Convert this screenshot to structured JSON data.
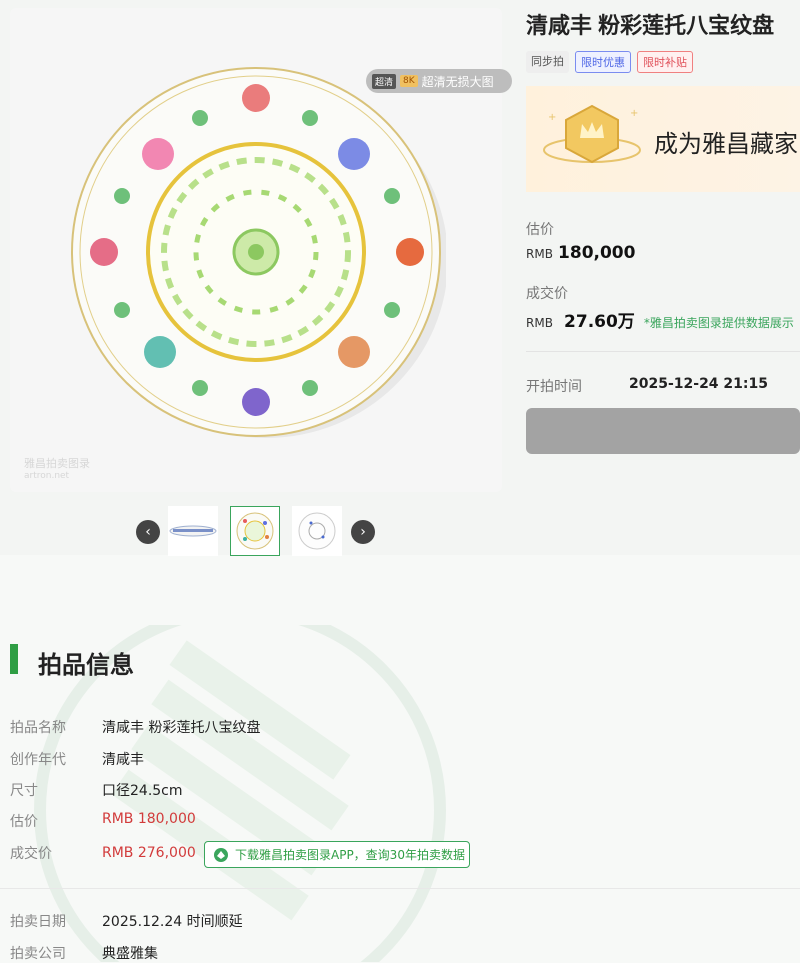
{
  "gallery": {
    "badge_tag1": "超清",
    "badge_tag2": "8K",
    "badge_text": "超清无损大图",
    "watermark_line1": "雅昌拍卖图录",
    "watermark_line2": "artron.net"
  },
  "lot": {
    "title": "清咸丰 粉彩莲托八宝纹盘",
    "tags": [
      "同步拍",
      "限时优惠",
      "限时补贴"
    ],
    "banner_text": "成为雅昌藏家",
    "estimate_label": "估价",
    "estimate_currency": "RMB",
    "estimate_value": "180,000",
    "deal_label": "成交价",
    "deal_currency": "RMB",
    "deal_value": "27.60万",
    "deal_note": "*雅昌拍卖图录提供数据展示",
    "start_label": "开拍时间",
    "start_value": "2025-12-24 21:15"
  },
  "info": {
    "section_title": "拍品信息",
    "rows": [
      {
        "k": "拍品名称",
        "v": "清咸丰 粉彩莲托八宝纹盘"
      },
      {
        "k": "创作年代",
        "v": "清咸丰"
      },
      {
        "k": "尺寸",
        "v": "口径24.5cm"
      },
      {
        "k": "估价",
        "v": "RMB 180,000"
      },
      {
        "k": "成交价",
        "v": "RMB 276,000"
      },
      {
        "k": "拍卖日期",
        "v": "2025.12.24 时间顺延"
      },
      {
        "k": "拍卖公司",
        "v": "典盛雅集"
      }
    ],
    "app_button": "下载雅昌拍卖图录APP，查询30年拍卖数据"
  },
  "colors": {
    "accent_green": "#2f9e44",
    "price_red": "#d23b3b"
  }
}
